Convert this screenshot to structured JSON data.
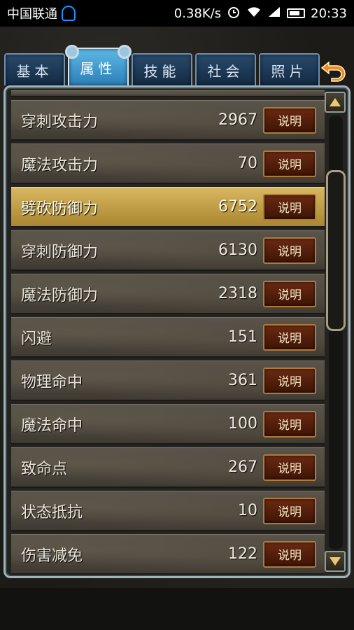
{
  "status_bar": {
    "carrier": "中国联通",
    "speed": "0.38K/s",
    "time": "20:33"
  },
  "tabs": [
    {
      "label": "基本",
      "active": false
    },
    {
      "label": "属性",
      "active": true
    },
    {
      "label": "技能",
      "active": false
    },
    {
      "label": "社会",
      "active": false
    },
    {
      "label": "照片",
      "active": false
    }
  ],
  "detail_label": "说明",
  "rows": [
    {
      "label": "穿刺攻击力",
      "value": "2967",
      "highlight": false
    },
    {
      "label": "魔法攻击力",
      "value": "70",
      "highlight": false
    },
    {
      "label": "劈砍防御力",
      "value": "6752",
      "highlight": true
    },
    {
      "label": "穿刺防御力",
      "value": "6130",
      "highlight": false
    },
    {
      "label": "魔法防御力",
      "value": "2318",
      "highlight": false
    },
    {
      "label": "闪避",
      "value": "151",
      "highlight": false
    },
    {
      "label": "物理命中",
      "value": "361",
      "highlight": false
    },
    {
      "label": "魔法命中",
      "value": "100",
      "highlight": false
    },
    {
      "label": "致命点",
      "value": "267",
      "highlight": false
    },
    {
      "label": "状态抵抗",
      "value": "10",
      "highlight": false
    },
    {
      "label": "伤害减免",
      "value": "122",
      "highlight": false
    }
  ],
  "colors": {
    "highlight": "#c9a548",
    "tab_active": "#4aa3d8",
    "button": "#5a2410"
  },
  "icons": {
    "back": "back-arrow-icon",
    "scroll_up": "scroll-up-icon",
    "scroll_down": "scroll-down-icon"
  }
}
